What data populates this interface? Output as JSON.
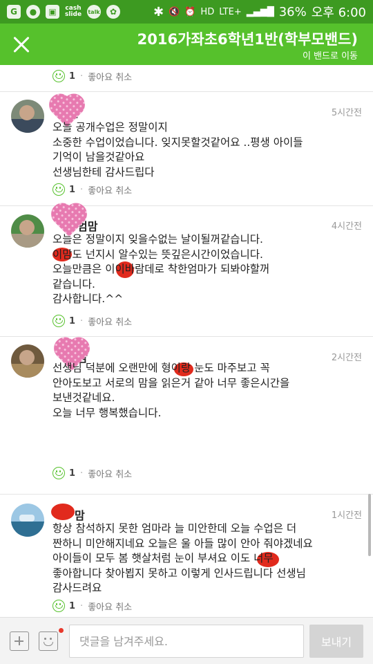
{
  "status_bar": {
    "left_icons": [
      "G",
      "●",
      "▣",
      "cash slide",
      "talk",
      "✿"
    ],
    "bluetooth": "✱",
    "mute": "🔇",
    "alarm": "⏰",
    "hd": "HD",
    "network": "LTE+",
    "signal": "▂▄▆█",
    "battery": "36%",
    "time": "오후 6:00"
  },
  "header": {
    "title": "2016가좌초6학년1반(학부모밴드)",
    "link": "이 밴드로 이동"
  },
  "top_actions": {
    "likes": "1",
    "like_cancel": "좋아요 취소"
  },
  "comments": [
    {
      "author": "맘",
      "time": "5시간전",
      "lines": [
        "오늘 공개수업은 정말이지",
        "소중한 수업이었습니다. 잊지못할것같어요 ..평생 아이들",
        "기억이 남을것같아요",
        "선생님한테 감사드립다"
      ],
      "likes": "1",
      "like_cancel": "좋아요 취소"
    },
    {
      "author": "엄맘",
      "time": "4시간전",
      "lines": [
        "오늘은 정말이지 잊을수없는 날이될꺼같습니다.",
        "    이맘도 넌지시 알수있는 뜻깊은시간이었습니다.",
        "오늘만큼은   이이바람데로 착한엄마가 되봐야할꺼",
        "같습니다.",
        "감사합니다.^^"
      ],
      "likes": "1",
      "like_cancel": "좋아요 취소"
    },
    {
      "author": "맘",
      "time": "2시간전",
      "lines": [
        "선생님 덕분에 오랜만에    형이랑 눈도 마주보고 꼭",
        "안아도보고 서로의 맘을 읽은거 같아 너무 좋은시간을",
        "보낸것같네요.",
        "오늘 너무 행복했습니다."
      ],
      "likes": "1",
      "like_cancel": "좋아요 취소"
    },
    {
      "author": "맘",
      "time": "1시간전",
      "lines": [
        "항상 참석하지 못한 엄마라 늘 미안한데 오늘 수업은 더",
        "짠하니 미안해지네요  오늘은 울 아들 많이 안아 줘야겠네요",
        "아이들이 모두 봄 햇살처럼  눈이 부셔요     이도 너무",
        "좋아합니다    찾아뵙지 못하고 이렇게 인사드립니다  선생님",
        "감사드려요"
      ],
      "likes": "1",
      "like_cancel": "좋아요 취소"
    }
  ],
  "input_bar": {
    "placeholder": "댓글을 남겨주세요.",
    "send_label": "보내기"
  },
  "colors": {
    "status_bar": "#3d9a21",
    "header": "#56c12c",
    "like_icon": "#56c12c",
    "heart_mark": "#e77ab0",
    "redaction_mark": "#e12a1d"
  }
}
